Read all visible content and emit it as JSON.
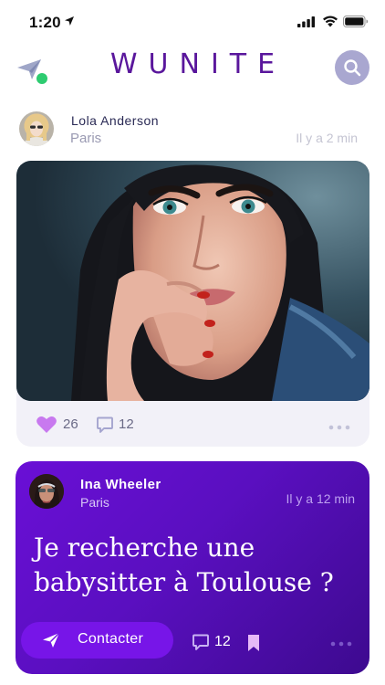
{
  "status_bar": {
    "time": "1:20",
    "icons": [
      "location-arrow-icon",
      "cellular-signal-icon",
      "wifi-icon",
      "battery-icon"
    ]
  },
  "header": {
    "logo": "WUNITE",
    "left_icon": "send-icon",
    "right_icon": "search-icon"
  },
  "feed": {
    "post1": {
      "author_name": "Lola Anderson",
      "city": "Paris",
      "time_ago": "Il y a 2 min",
      "likes": "26",
      "comments": "12"
    },
    "post2": {
      "author_name": "Ina Wheeler",
      "city": "Paris",
      "time_ago": "Il y a 12 min",
      "message": "Je recherche une babysitter à Toulouse ?",
      "contact_label": "Contacter",
      "comments": "12"
    }
  },
  "colors": {
    "brand": "#5a179c",
    "accent_purple": "#6a0fd6",
    "like": "#c879ef",
    "online": "#2ecc71",
    "search_bg": "#a9a7d0"
  }
}
